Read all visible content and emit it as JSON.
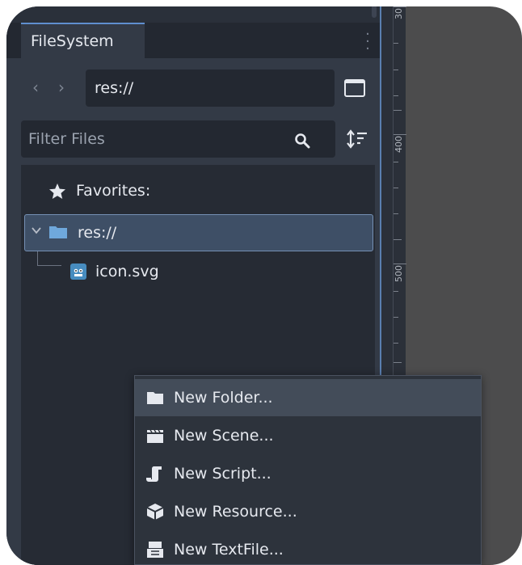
{
  "panel": {
    "tab_label": "FileSystem",
    "tab_menu_icon": "vertical-dots-icon",
    "path": "res://",
    "filter_placeholder": "Filter Files"
  },
  "tree": {
    "favorites_label": "Favorites:",
    "root_label": "res://",
    "files": [
      {
        "label": "icon.svg",
        "icon": "godot-icon"
      }
    ]
  },
  "ruler": {
    "labels": [
      "30",
      "400",
      "500"
    ]
  },
  "context_menu": {
    "items": [
      {
        "label": "New Folder...",
        "icon": "folder-icon"
      },
      {
        "label": "New Scene...",
        "icon": "clapperboard-icon"
      },
      {
        "label": "New Script...",
        "icon": "script-icon"
      },
      {
        "label": "New Resource...",
        "icon": "cube-icon"
      },
      {
        "label": "New TextFile...",
        "icon": "text-file-icon"
      }
    ]
  },
  "colors": {
    "accent": "#5f8fcf",
    "selection": "#3e4f66",
    "panel_bg": "#333a46",
    "text": "#e6e9ef"
  }
}
